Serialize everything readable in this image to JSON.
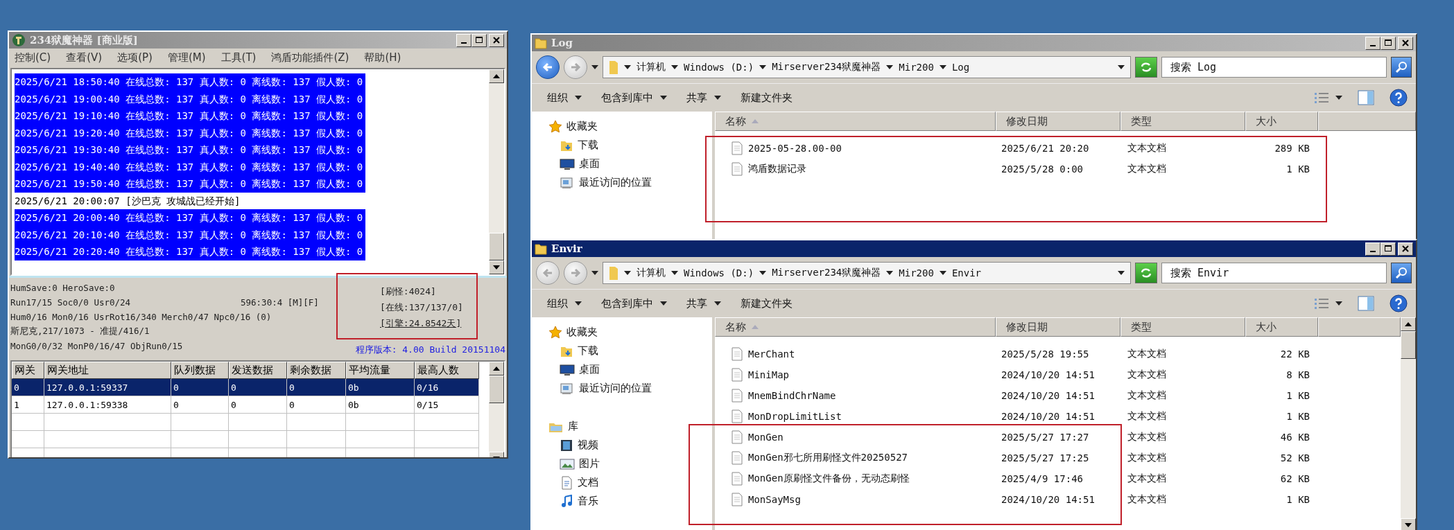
{
  "server_window": {
    "title": "234狱魔神器 [商业版]",
    "active": false,
    "menu": [
      "控制(C)",
      "查看(V)",
      "选项(P)",
      "管理(M)",
      "工具(T)",
      "鸿盾功能插件(Z)",
      "帮助(H)"
    ],
    "log": [
      {
        "text": "2025/6/21 18:50:40 在线总数: 137 真人数: 0 离线数: 137 假人数: 0",
        "selected": true
      },
      {
        "text": "2025/6/21 19:00:40 在线总数: 137 真人数: 0 离线数: 137 假人数: 0",
        "selected": true
      },
      {
        "text": "2025/6/21 19:10:40 在线总数: 137 真人数: 0 离线数: 137 假人数: 0",
        "selected": true
      },
      {
        "text": "2025/6/21 19:20:40 在线总数: 137 真人数: 0 离线数: 137 假人数: 0",
        "selected": true
      },
      {
        "text": "2025/6/21 19:30:40 在线总数: 137 真人数: 0 离线数: 137 假人数: 0",
        "selected": true
      },
      {
        "text": "2025/6/21 19:40:40 在线总数: 137 真人数: 0 离线数: 137 假人数: 0",
        "selected": true
      },
      {
        "text": "2025/6/21 19:50:40 在线总数: 137 真人数: 0 离线数: 137 假人数: 0",
        "selected": true
      },
      {
        "text": "2025/6/21 20:00:07 [沙巴克 攻城战已经开始]",
        "selected": false
      },
      {
        "text": "2025/6/21 20:00:40 在线总数: 137 真人数: 0 离线数: 137 假人数: 0",
        "selected": true
      },
      {
        "text": "2025/6/21 20:10:40 在线总数: 137 真人数: 0 离线数: 137 假人数: 0",
        "selected": true
      },
      {
        "text": "2025/6/21 20:20:40 在线总数: 137 真人数: 0 离线数: 137 假人数: 0",
        "selected": true
      }
    ],
    "status_lines": [
      {
        "text": "HumSave:0 HeroSave:0"
      },
      {
        "text": "Run17/15 Soc0/0 Usr0/24",
        "aside": "596:30:4 [M][F]"
      },
      {
        "text": "Hum0/16 Mon0/16 UsrRot16/340 Merch0/47 Npc0/16 (0)"
      },
      {
        "text": "斯尼克,217/1073 - 准提/416/1"
      },
      {
        "text": "MonG0/0/32 MonP0/16/47 ObjRun0/15"
      }
    ],
    "stats": [
      {
        "text": "[刷怪:4024]",
        "underlined": false
      },
      {
        "text": "[在线:137/137/0]",
        "underlined": false
      },
      {
        "text": "[引擎:24.8542天]",
        "underlined": true
      }
    ],
    "version": "程序版本: 4.00 Build 20151104",
    "gateways": {
      "columns": [
        "网关",
        "网关地址",
        "队列数据",
        "发送数据",
        "剩余数据",
        "平均流量",
        "最高人数"
      ],
      "rows": [
        {
          "cells": [
            "0",
            "127.0.0.1:59337",
            "0",
            "0",
            "0",
            "0b",
            "0/16"
          ],
          "selected": true
        },
        {
          "cells": [
            "1",
            "127.0.0.1:59338",
            "0",
            "0",
            "0",
            "0b",
            "0/15"
          ],
          "selected": false
        }
      ]
    }
  },
  "explorer_windows": [
    {
      "title": "Log",
      "active": false,
      "back_enabled": true,
      "scrollbar": false,
      "breadcrumb": [
        "计算机",
        "Windows (D:)",
        "Mirserver234狱魔神器",
        "Mir200",
        "Log"
      ],
      "search": {
        "placeholder": "搜索 Log"
      },
      "toolbar": [
        {
          "label": "组织",
          "dropdown": true
        },
        {
          "label": "包含到库中",
          "dropdown": true
        },
        {
          "label": "共享",
          "dropdown": true
        },
        {
          "label": "新建文件夹",
          "dropdown": false
        }
      ],
      "nav": [
        {
          "label": "收藏夹",
          "kind": "favorites",
          "children": [
            {
              "label": "下载",
              "kind": "downloads"
            },
            {
              "label": "桌面",
              "kind": "desktop"
            },
            {
              "label": "最近访问的位置",
              "kind": "recent"
            }
          ]
        }
      ],
      "columns": [
        {
          "label": "名称",
          "sorted": true
        },
        {
          "label": "修改日期",
          "sorted": false
        },
        {
          "label": "类型",
          "sorted": false
        },
        {
          "label": "大小",
          "sorted": false
        }
      ],
      "files": [
        {
          "name": "2025-05-28.00-00",
          "modified": "2025/6/21 20:20",
          "type": "文本文档",
          "size": "289 KB"
        },
        {
          "name": "鸿盾数据记录",
          "modified": "2025/5/28 0:00",
          "type": "文本文档",
          "size": "1 KB"
        }
      ]
    },
    {
      "title": "Envir",
      "active": true,
      "back_enabled": false,
      "scrollbar": true,
      "breadcrumb": [
        "计算机",
        "Windows (D:)",
        "Mirserver234狱魔神器",
        "Mir200",
        "Envir"
      ],
      "search": {
        "placeholder": "搜索 Envir"
      },
      "toolbar": [
        {
          "label": "组织",
          "dropdown": true
        },
        {
          "label": "包含到库中",
          "dropdown": true
        },
        {
          "label": "共享",
          "dropdown": true
        },
        {
          "label": "新建文件夹",
          "dropdown": false
        }
      ],
      "nav": [
        {
          "label": "收藏夹",
          "kind": "favorites",
          "children": [
            {
              "label": "下载",
              "kind": "downloads"
            },
            {
              "label": "桌面",
              "kind": "desktop"
            },
            {
              "label": "最近访问的位置",
              "kind": "recent"
            }
          ]
        },
        {
          "label": "库",
          "kind": "library",
          "children": [
            {
              "label": "视频",
              "kind": "video"
            },
            {
              "label": "图片",
              "kind": "pictures"
            },
            {
              "label": "文档",
              "kind": "documents"
            },
            {
              "label": "音乐",
              "kind": "music"
            }
          ]
        }
      ],
      "columns": [
        {
          "label": "名称",
          "sorted": true
        },
        {
          "label": "修改日期",
          "sorted": false
        },
        {
          "label": "类型",
          "sorted": false
        },
        {
          "label": "大小",
          "sorted": false
        }
      ],
      "files": [
        {
          "name": "MerChant",
          "modified": "2025/5/28 19:55",
          "type": "文本文档",
          "size": "22 KB"
        },
        {
          "name": "MiniMap",
          "modified": "2024/10/20 14:51",
          "type": "文本文档",
          "size": "8 KB"
        },
        {
          "name": "MnemBindChrName",
          "modified": "2024/10/20 14:51",
          "type": "文本文档",
          "size": "1 KB"
        },
        {
          "name": "MonDropLimitList",
          "modified": "2024/10/20 14:51",
          "type": "文本文档",
          "size": "1 KB"
        },
        {
          "name": "MonGen",
          "modified": "2025/5/27 17:27",
          "type": "文本文档",
          "size": "46 KB"
        },
        {
          "name": "MonGen邪七所用刷怪文件20250527",
          "modified": "2025/5/27 17:25",
          "type": "文本文档",
          "size": "52 KB"
        },
        {
          "name": "MonGen原刷怪文件备份，无动态刷怪",
          "modified": "2025/4/9 17:46",
          "type": "文本文档",
          "size": "62 KB"
        },
        {
          "name": "MonSayMsg",
          "modified": "2024/10/20 14:51",
          "type": "文本文档",
          "size": "1 KB"
        }
      ]
    }
  ]
}
